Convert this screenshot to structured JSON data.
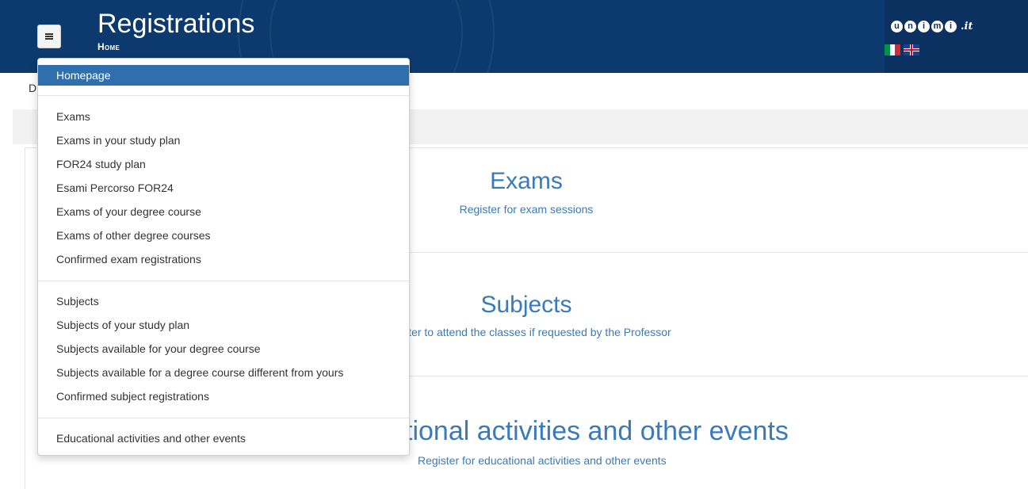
{
  "header": {
    "title": "Registrations",
    "subtitle": "Home",
    "logo_letters": [
      "u",
      "n",
      "i",
      "m",
      "i"
    ],
    "logo_tld": ".it"
  },
  "colors": {
    "header_bg": "#0d3a6e",
    "accent": "#2f6fae",
    "link": "#3a7ab8"
  },
  "breadcrumb": "D",
  "menu": {
    "items": [
      "Homepage",
      "Exams",
      "Exams in your study plan",
      "FOR24 study plan",
      "Esami Percorso FOR24",
      "Exams of your degree course",
      "Exams of other degree courses",
      "Confirmed exam registrations",
      "Subjects",
      "Subjects of your study plan",
      "Subjects available for your degree course",
      "Subjects available for a degree course different from yours",
      "Confirmed subject registrations",
      "Educational activities and other events"
    ]
  },
  "sections": [
    {
      "title": "Exams",
      "description": "Register for exam sessions"
    },
    {
      "title": "Subjects",
      "description": "gister to attend the classes if requested by the Professor"
    },
    {
      "title": "tional activities and other events",
      "description": "Register for educational activities and other events"
    }
  ]
}
